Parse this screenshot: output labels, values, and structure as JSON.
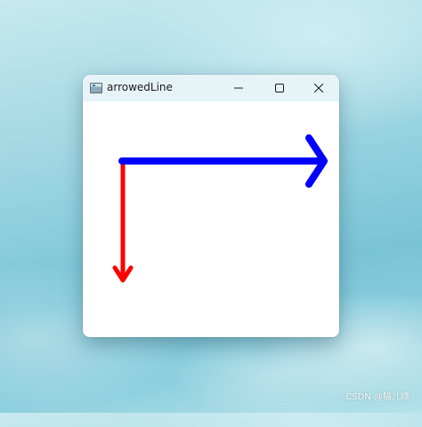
{
  "window": {
    "title": "arrowedLine"
  },
  "titlebar_buttons": {
    "minimize_icon": "minimize-icon",
    "maximize_icon": "maximize-icon",
    "close_icon": "close-icon"
  },
  "canvas": {
    "background": "#ffffff",
    "arrows": [
      {
        "name": "blue-arrow",
        "color": "#0000ff"
      },
      {
        "name": "red-arrow",
        "color": "#ff0000"
      }
    ]
  },
  "desktop": {
    "watermark": "CSDN @猫儿缘"
  }
}
